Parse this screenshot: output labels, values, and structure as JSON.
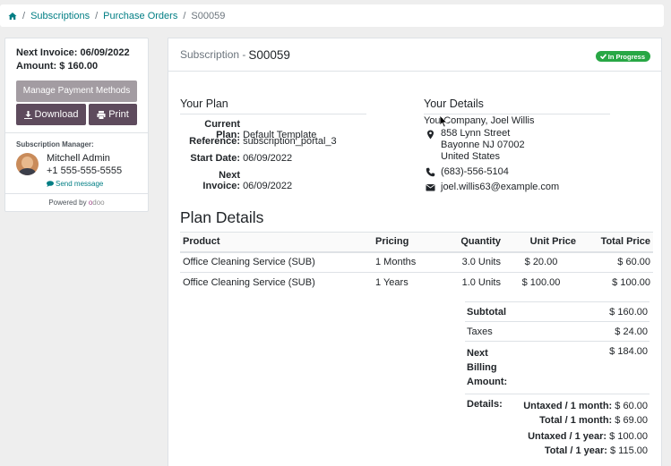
{
  "breadcrumb": {
    "items": [
      "Subscriptions",
      "Purchase Orders"
    ],
    "current": "S00059"
  },
  "sidebar": {
    "next_invoice": "Next Invoice: 06/09/2022",
    "amount": "Amount: $ 160.00",
    "manage_label": "Manage Payment Methods",
    "download_label": "Download",
    "print_label": "Print",
    "manager_label": "Subscription Manager:",
    "manager_name": "Mitchell Admin",
    "manager_phone": "+1 555-555-5555",
    "send_message": "Send message",
    "powered_by": "Powered by",
    "odoo_o": "o",
    "odoo_rest": "doo"
  },
  "header": {
    "label": "Subscription -",
    "name": "S00059",
    "status": "In Progress"
  },
  "plan": {
    "title": "Your Plan",
    "rows": [
      {
        "key": "Current Plan:",
        "value": "Default Template"
      },
      {
        "key": "Reference:",
        "value": "subscription_portal_3"
      },
      {
        "key": "Start Date:",
        "value": "06/09/2022"
      },
      {
        "key": "Next Invoice:",
        "value": "06/09/2022"
      }
    ]
  },
  "details": {
    "title": "Your Details",
    "company": "YourCompany, Joel Willis",
    "address": [
      "858 Lynn Street",
      "Bayonne NJ 07002",
      "United States"
    ],
    "phone": "(683)-556-5104",
    "email": "joel.willis63@example.com"
  },
  "plan_details": {
    "title": "Plan Details",
    "columns": [
      "Product",
      "Pricing",
      "Quantity",
      "Unit Price",
      "Total Price"
    ],
    "rows": [
      [
        "Office Cleaning Service (SUB)",
        "1 Months",
        "3.0 Units",
        "$ 20.00",
        "$ 60.00"
      ],
      [
        "Office Cleaning Service (SUB)",
        "1 Years",
        "1.0 Units",
        "$ 100.00",
        "$ 100.00"
      ]
    ]
  },
  "totals": {
    "subtotal_label": "Subtotal",
    "subtotal": "$ 160.00",
    "taxes_label": "Taxes",
    "taxes": "$ 24.00",
    "next_billing_label": "Next Billing Amount:",
    "next_billing": "$ 184.00",
    "details_label": "Details:",
    "untaxed_month_label": "Untaxed / 1 month:",
    "untaxed_month": "$ 60.00",
    "total_month_label": "Total / 1 month:",
    "total_month": "$ 69.00",
    "untaxed_year_label": "Untaxed / 1 year:",
    "untaxed_year": "$ 100.00",
    "total_year_label": "Total / 1 year:",
    "total_year": "$ 115.00"
  },
  "colors": {
    "accent": "#017e84",
    "button_dark": "#5e4b5d",
    "button_muted": "#a39ca2",
    "success": "#28a745"
  }
}
